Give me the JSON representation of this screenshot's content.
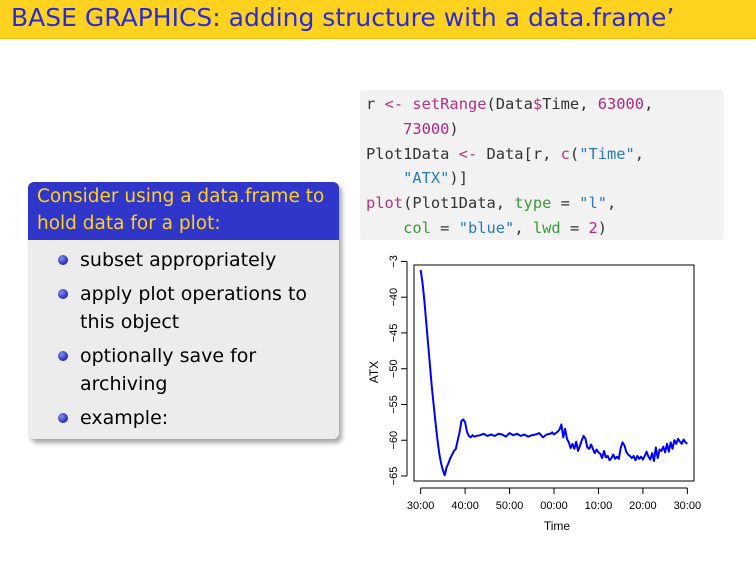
{
  "slide": {
    "title": "BASE GRAPHICS: adding structure with a data.frame’",
    "block": {
      "heading_line1": "Consider using a data.frame to",
      "heading_line2": "hold data for a plot:",
      "items": [
        {
          "line1": "subset appropriately",
          "line2": ""
        },
        {
          "line1": "apply plot operations to",
          "line2": "this object"
        },
        {
          "line1": "optionally save for",
          "line2": "archiving"
        },
        {
          "line1": "example:",
          "line2": ""
        }
      ]
    },
    "code": {
      "l1_a": "r ",
      "l1_op": "<- ",
      "l1_fn": "setRange",
      "l1_b": "(Data",
      "l1_dollar": "$",
      "l1_c": "Time, ",
      "l1_n1": "63000",
      "l1_d": ",",
      "l2_n2": "73000",
      "l2_e": ")",
      "l3_a": "Plot1Data ",
      "l3_op": "<- ",
      "l3_b": "Data[r, ",
      "l3_fn": "c",
      "l3_c": "(",
      "l3_s1": "\"Time\"",
      "l3_d": ",",
      "l4_s2": "\"ATX\"",
      "l4_e": ")]",
      "l5_fn": "plot",
      "l5_a": "(Plot1Data, ",
      "l5_arg1": "type",
      "l5_b": " = ",
      "l5_s3": "\"l\"",
      "l5_c": ",",
      "l6_arg2": "col",
      "l6_b": " = ",
      "l6_s4": "\"blue\"",
      "l6_c": ", ",
      "l6_arg3": "lwd",
      "l6_d": " = ",
      "l6_n3": "2",
      "l6_e": ")"
    }
  },
  "colors": {
    "title_bar": "#ffd21f",
    "title_text": "#2b2bd6",
    "block_header": "#2f36c9",
    "block_header_text": "#ffd21f",
    "series_line": "#0000ff"
  },
  "chart_data": {
    "type": "line",
    "title": "",
    "xlabel": "Time",
    "ylabel": "ATX",
    "x_tick_labels": [
      "30:00",
      "40:00",
      "50:00",
      "00:00",
      "10:00",
      "20:00",
      "30:00"
    ],
    "x_ticks_seconds": [
      63000,
      64200,
      65400,
      66600,
      67800,
      69000,
      70200
    ],
    "y_ticks": [
      -65,
      -60,
      -55,
      -50,
      -45,
      -40,
      -35
    ],
    "y_tick_labels": [
      "−65",
      "−60",
      "−55",
      "−50",
      "−45",
      "−40",
      "−3"
    ],
    "xlim": [
      62820,
      70380
    ],
    "ylim": [
      -65.7,
      -35.5
    ],
    "grid": false,
    "series": [
      {
        "color": "#0000ff",
        "x": [
          63000,
          63050,
          63100,
          63150,
          63200,
          63250,
          63300,
          63350,
          63400,
          63450,
          63500,
          63550,
          63600,
          63650,
          63700,
          63750,
          63800,
          63850,
          63900,
          63950,
          64000,
          64050,
          64100,
          64150,
          64200,
          64250,
          64300,
          64350,
          64400,
          64450,
          64500,
          64600,
          64700,
          64800,
          64900,
          65000,
          65100,
          65200,
          65300,
          65400,
          65500,
          65600,
          65700,
          65800,
          65900,
          66000,
          66100,
          66200,
          66300,
          66400,
          66500,
          66550,
          66600,
          66650,
          66700,
          66750,
          66800,
          66850,
          66900,
          66950,
          67000,
          67050,
          67100,
          67150,
          67200,
          67250,
          67300,
          67350,
          67400,
          67450,
          67500,
          67550,
          67600,
          67650,
          67700,
          67750,
          67800,
          67850,
          67900,
          67950,
          68000,
          68050,
          68100,
          68150,
          68200,
          68250,
          68300,
          68350,
          68400,
          68450,
          68500,
          68550,
          68600,
          68650,
          68700,
          68750,
          68800,
          68850,
          68900,
          68950,
          69000,
          69050,
          69100,
          69150,
          69200,
          69250,
          69300,
          69350,
          69400,
          69450,
          69500,
          69550,
          69600,
          69650,
          69700,
          69750,
          69800,
          69850,
          69900,
          69950,
          70000,
          70050,
          70100,
          70150,
          70200
        ],
        "y": [
          -36.2,
          -38.0,
          -40.5,
          -43.5,
          -46.5,
          -49.5,
          -52.5,
          -55.0,
          -57.5,
          -59.8,
          -61.8,
          -63.2,
          -64.2,
          -64.9,
          -63.8,
          -63.2,
          -62.5,
          -62.0,
          -61.5,
          -61.2,
          -60.0,
          -58.9,
          -57.3,
          -57.1,
          -57.5,
          -58.8,
          -59.4,
          -59.6,
          -59.3,
          -59.5,
          -59.4,
          -59.3,
          -59.1,
          -59.4,
          -59.2,
          -59.4,
          -59.1,
          -59.2,
          -59.5,
          -59.0,
          -59.3,
          -59.1,
          -59.4,
          -59.2,
          -59.5,
          -59.3,
          -59.2,
          -59.0,
          -59.6,
          -59.2,
          -59.1,
          -58.9,
          -59.2,
          -59.0,
          -58.8,
          -58.5,
          -57.8,
          -59.6,
          -58.4,
          -59.8,
          -60.3,
          -61.1,
          -60.5,
          -61.2,
          -60.2,
          -61.5,
          -60.8,
          -60.0,
          -59.4,
          -59.8,
          -61.0,
          -61.2,
          -60.6,
          -61.2,
          -61.8,
          -61.3,
          -61.7,
          -61.9,
          -62.5,
          -61.5,
          -62.4,
          -62.2,
          -62.8,
          -62.5,
          -62.0,
          -62.6,
          -62.3,
          -62.6,
          -61.1,
          -60.3,
          -60.7,
          -61.6,
          -62.0,
          -62.2,
          -62.5,
          -62.2,
          -62.8,
          -62.2,
          -62.6,
          -62.3,
          -62.7,
          -62.2,
          -61.6,
          -62.3,
          -62.7,
          -61.8,
          -62.9,
          -61.0,
          -62.5,
          -61.3,
          -61.5,
          -60.9,
          -61.7,
          -60.5,
          -61.6,
          -60.3,
          -61.2,
          -60.0,
          -60.5,
          -59.8,
          -60.2,
          -60.5,
          -59.9,
          -60.3,
          -60.5
        ]
      }
    ]
  }
}
